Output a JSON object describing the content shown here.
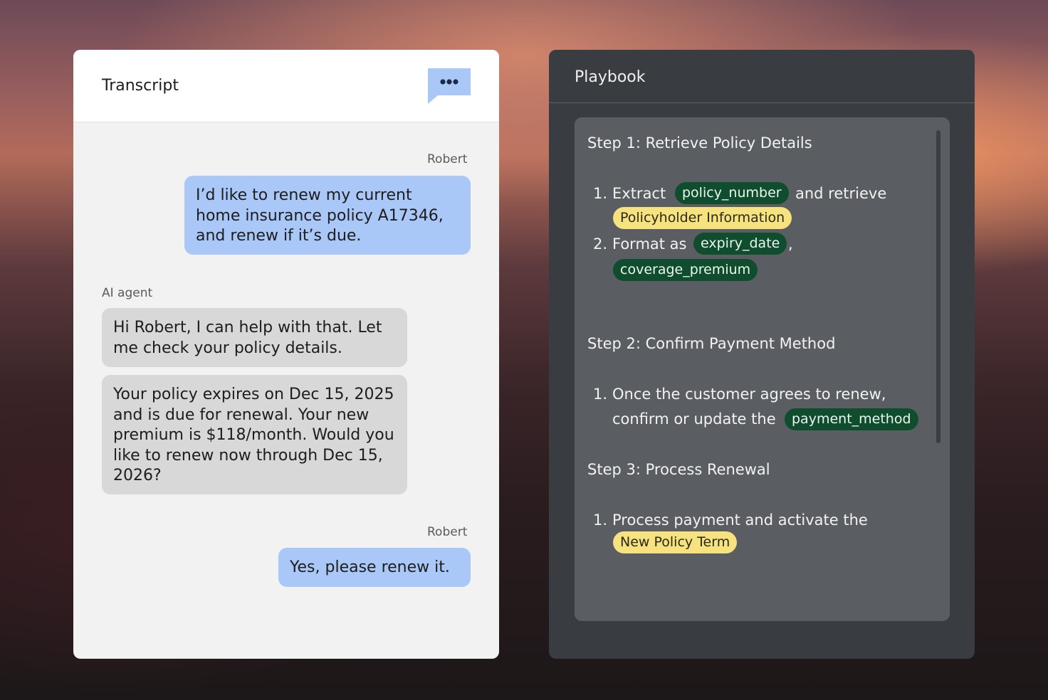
{
  "transcript": {
    "title": "Transcript",
    "messages": [
      {
        "sender": "Robert",
        "text": "I’d like to renew my current home insurance policy A17346, and renew if it’s due."
      },
      {
        "sender": "AI agent",
        "text": "Hi Robert, I can help with that. Let me check your policy details."
      },
      {
        "sender": "",
        "text": "Your policy expires on Dec 15, 2025 and is due for renewal. Your new premium is $118/month. Would you like to renew now through Dec 15, 2026?"
      },
      {
        "sender": "Robert",
        "text": "Yes, please renew it."
      }
    ]
  },
  "playbook": {
    "title": "Playbook",
    "steps": [
      {
        "title": "Step 1: Retrieve Policy Details",
        "items": [
          {
            "num": "1.",
            "text_a": "Extract",
            "chip_a": "policy_number",
            "text_b": "and retrieve",
            "chip_b": "Policyholder Information"
          },
          {
            "num": "2.",
            "text_a": "Format as",
            "chip_a": "expiry_date",
            "text_b": ",",
            "chip_b": "coverage_premium"
          }
        ]
      },
      {
        "title": "Step 2: Confirm Payment Method",
        "items": [
          {
            "num": "1.",
            "text_a": "Once the customer agrees to renew,",
            "text_b": "confirm or update the",
            "chip_a": "payment_method"
          }
        ]
      },
      {
        "title": "Step 3: Process Renewal",
        "items": [
          {
            "num": "1.",
            "text_a": "Process payment and activate the",
            "chip_a": "New Policy Term"
          }
        ]
      }
    ]
  },
  "colors": {
    "user_bubble": "#aac8f7",
    "agent_bubble": "#d8d8d8",
    "variable_chip": "#0f4d2e",
    "object_chip": "#f6e27e",
    "chat_icon": "#aac8f7"
  },
  "icons": {
    "chat": "chat-bubble-ellipsis-icon"
  }
}
